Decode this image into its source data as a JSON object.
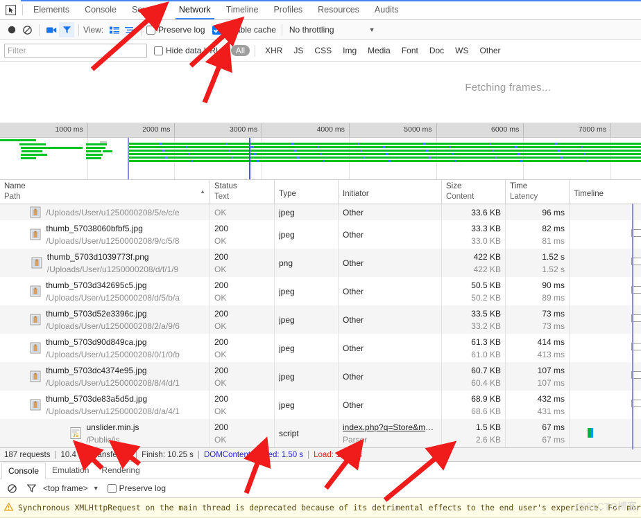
{
  "devtools": {
    "tabs": [
      {
        "label": "Elements",
        "active": false
      },
      {
        "label": "Console",
        "active": false
      },
      {
        "label": "Sources",
        "active": false
      },
      {
        "label": "Network",
        "active": true
      },
      {
        "label": "Timeline",
        "active": false
      },
      {
        "label": "Profiles",
        "active": false
      },
      {
        "label": "Resources",
        "active": false
      },
      {
        "label": "Audits",
        "active": false
      }
    ],
    "inspect_icon": "inspect-element-icon"
  },
  "toolbar": {
    "record_icon": "record-circle-icon",
    "clear_icon": "clear-no-entry-icon",
    "capture_screenshots_icon": "camera-icon",
    "filter_icon": "funnel-icon",
    "view_label": "View:",
    "view_list_icon": "list-view-icon",
    "view_timeline_icon": "timeline-view-icon",
    "preserve_log_label": "Preserve log",
    "preserve_log_checked": false,
    "disable_cache_label": "Disable cache",
    "disable_cache_checked": true,
    "throttling_label": "No throttling",
    "throttling_caret": "▼"
  },
  "filterbar": {
    "filter_placeholder": "Filter",
    "filter_value": "",
    "hide_data_urls_label": "Hide data URLs",
    "hide_data_urls_checked": false,
    "types": [
      {
        "label": "All",
        "active": true
      },
      {
        "label": "XHR",
        "active": false
      },
      {
        "label": "JS",
        "active": false
      },
      {
        "label": "CSS",
        "active": false
      },
      {
        "label": "Img",
        "active": false
      },
      {
        "label": "Media",
        "active": false
      },
      {
        "label": "Font",
        "active": false
      },
      {
        "label": "Doc",
        "active": false
      },
      {
        "label": "WS",
        "active": false
      },
      {
        "label": "Other",
        "active": false
      }
    ]
  },
  "overview": {
    "fetching_label": "Fetching frames..."
  },
  "ruler": {
    "ticks": [
      "1000 ms",
      "2000 ms",
      "3000 ms",
      "4000 ms",
      "5000 ms",
      "6000 ms",
      "7000 ms"
    ]
  },
  "table": {
    "columns": [
      {
        "top": "Name",
        "bottom": "Path",
        "sorted": true,
        "sort_arrow": "▲"
      },
      {
        "top": "Status",
        "bottom": "Text"
      },
      {
        "top": "Type",
        "bottom": ""
      },
      {
        "top": "Initiator",
        "bottom": ""
      },
      {
        "top": "Size",
        "bottom": "Content"
      },
      {
        "top": "Time",
        "bottom": "Latency"
      },
      {
        "top": "Timeline",
        "bottom": ""
      }
    ],
    "rows": [
      {
        "icon": "image-thumbnail-icon",
        "name": "",
        "path": "/Uploads/User/u1250000208/5/e/c/e",
        "status": "",
        "status_text": "OK",
        "type": "jpeg",
        "initiator": "Other",
        "initiator_sub": "",
        "size": "33.6 KB",
        "content": "",
        "time": "96 ms",
        "latency": "",
        "clipped": true
      },
      {
        "icon": "image-thumbnail-icon",
        "name": "thumb_57038060bfbf5.jpg",
        "path": "/Uploads/User/u1250000208/9/c/5/8",
        "status": "200",
        "status_text": "OK",
        "type": "jpeg",
        "initiator": "Other",
        "initiator_sub": "",
        "size": "33.3 KB",
        "content": "33.0 KB",
        "time": "82 ms",
        "latency": "81 ms",
        "clipped": false
      },
      {
        "icon": "image-thumbnail-icon",
        "name": "thumb_5703d1039773f.png",
        "path": "/Uploads/User/u1250000208/d/f/1/9",
        "status": "200",
        "status_text": "OK",
        "type": "png",
        "initiator": "Other",
        "initiator_sub": "",
        "size": "422 KB",
        "content": "422 KB",
        "time": "1.52 s",
        "latency": "1.52 s",
        "clipped": false
      },
      {
        "icon": "image-thumbnail-icon",
        "name": "thumb_5703d342695c5.jpg",
        "path": "/Uploads/User/u1250000208/d/5/b/a",
        "status": "200",
        "status_text": "OK",
        "type": "jpeg",
        "initiator": "Other",
        "initiator_sub": "",
        "size": "50.5 KB",
        "content": "50.2 KB",
        "time": "90 ms",
        "latency": "89 ms",
        "clipped": false
      },
      {
        "icon": "image-thumbnail-icon",
        "name": "thumb_5703d52e3396c.jpg",
        "path": "/Uploads/User/u1250000208/2/a/9/6",
        "status": "200",
        "status_text": "OK",
        "type": "jpeg",
        "initiator": "Other",
        "initiator_sub": "",
        "size": "33.5 KB",
        "content": "33.2 KB",
        "time": "73 ms",
        "latency": "73 ms",
        "clipped": false
      },
      {
        "icon": "image-thumbnail-icon",
        "name": "thumb_5703d90d849ca.jpg",
        "path": "/Uploads/User/u1250000208/0/1/0/b",
        "status": "200",
        "status_text": "OK",
        "type": "jpeg",
        "initiator": "Other",
        "initiator_sub": "",
        "size": "61.3 KB",
        "content": "61.0 KB",
        "time": "414 ms",
        "latency": "413 ms",
        "clipped": false
      },
      {
        "icon": "image-thumbnail-icon",
        "name": "thumb_5703dc4374e95.jpg",
        "path": "/Uploads/User/u1250000208/8/4/d/1",
        "status": "200",
        "status_text": "OK",
        "type": "jpeg",
        "initiator": "Other",
        "initiator_sub": "",
        "size": "60.7 KB",
        "content": "60.4 KB",
        "time": "107 ms",
        "latency": "107 ms",
        "clipped": false
      },
      {
        "icon": "image-thumbnail-icon",
        "name": "thumb_5703de83a5d5d.jpg",
        "path": "/Uploads/User/u1250000208/d/a/4/1",
        "status": "200",
        "status_text": "OK",
        "type": "jpeg",
        "initiator": "Other",
        "initiator_sub": "",
        "size": "68.9 KB",
        "content": "68.6 KB",
        "time": "432 ms",
        "latency": "431 ms",
        "clipped": false
      },
      {
        "icon": "js-file-icon",
        "name": "unslider.min.js",
        "path": "/Public/js",
        "status": "200",
        "status_text": "OK",
        "type": "script",
        "initiator": "index.php?q=Store&m=Ma...",
        "initiator_sub": "Parser",
        "size": "1.5 KB",
        "content": "2.6 KB",
        "time": "67 ms",
        "latency": "67 ms",
        "clipped": false,
        "initiator_is_link": true,
        "waterfall": true
      }
    ]
  },
  "statusbar": {
    "requests": "187 requests",
    "transferred": "10.4 MB transferred",
    "finish": "Finish: 10.25 s",
    "domcontentloaded": "DOMContentLoaded: 1.50 s",
    "load": "Load: 10.25 s",
    "separator": "|",
    "dcl_color": "#2727c6",
    "load_color": "#e02020"
  },
  "drawer": {
    "tabs": [
      {
        "label": "Console",
        "active": true
      },
      {
        "label": "Emulation",
        "active": false
      },
      {
        "label": "Rendering",
        "active": false
      }
    ],
    "clear_icon": "clear-no-entry-icon",
    "filter_icon": "funnel-icon",
    "frame_label": "<top frame>",
    "frame_caret": "▼",
    "preserve_log_label": "Preserve log",
    "preserve_log_checked": false,
    "message_icon": "warning-triangle-icon",
    "message": "Synchronous XMLHttpRequest on the main thread is deprecated because of its detrimental effects to the end user's experience. For more help",
    "watermark": "@51CTO博客"
  },
  "annotations": {
    "arrow_color": "#f01c1c",
    "arrows": [
      {
        "name": "arrow-to-network-tab"
      },
      {
        "name": "arrow-to-disable-cache"
      },
      {
        "name": "arrow-to-all-filter"
      },
      {
        "name": "arrow-to-requests-count"
      },
      {
        "name": "arrow-to-transferred"
      },
      {
        "name": "arrow-to-finish"
      },
      {
        "name": "arrow-to-domcontentloaded"
      },
      {
        "name": "arrow-to-load"
      }
    ]
  }
}
